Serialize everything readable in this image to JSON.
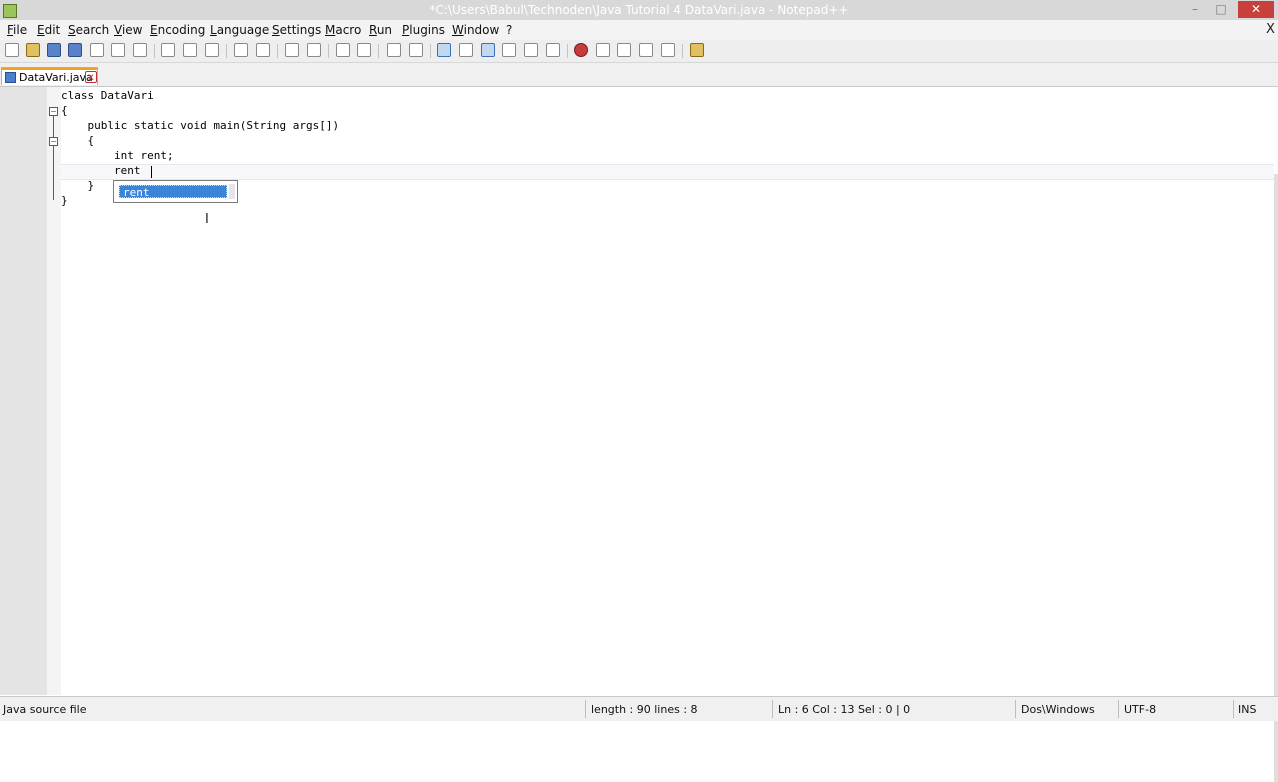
{
  "window": {
    "title": "*C:\\Users\\Babul\\Technoden\\Java Tutorial 4 DataVari.java - Notepad++",
    "minimize_glyph": "–",
    "maximize_glyph": "□",
    "close_glyph": "✕"
  },
  "menu": {
    "items": [
      "File",
      "Edit",
      "Search",
      "View",
      "Encoding",
      "Language",
      "Settings",
      "Macro",
      "Run",
      "Plugins",
      "Window",
      "?"
    ],
    "close_glyph": "X"
  },
  "tab": {
    "label": "DataVari.java",
    "close_glyph": "x"
  },
  "editor": {
    "lines": {
      "l1": "class DataVari",
      "l2": "{",
      "l3": "    public static void main(String args[])",
      "l4": "    {",
      "l5": "        int rent;",
      "l6": "        rent",
      "l7": "    }",
      "l8": "}"
    },
    "autocomplete": {
      "selected": "rent"
    },
    "mouse_cursor_glyph": "I"
  },
  "status": {
    "file_type": "Java source file",
    "length_lines": "length : 90    lines : 8",
    "position": "Ln : 6    Col : 13    Sel : 0 | 0",
    "eol": "Dos\\Windows",
    "encoding": "UTF-8",
    "mode": "INS"
  },
  "colors": {
    "tab_accent": "#f0a020",
    "selection": "#3c84d8",
    "fold_marker": "#c03030"
  }
}
